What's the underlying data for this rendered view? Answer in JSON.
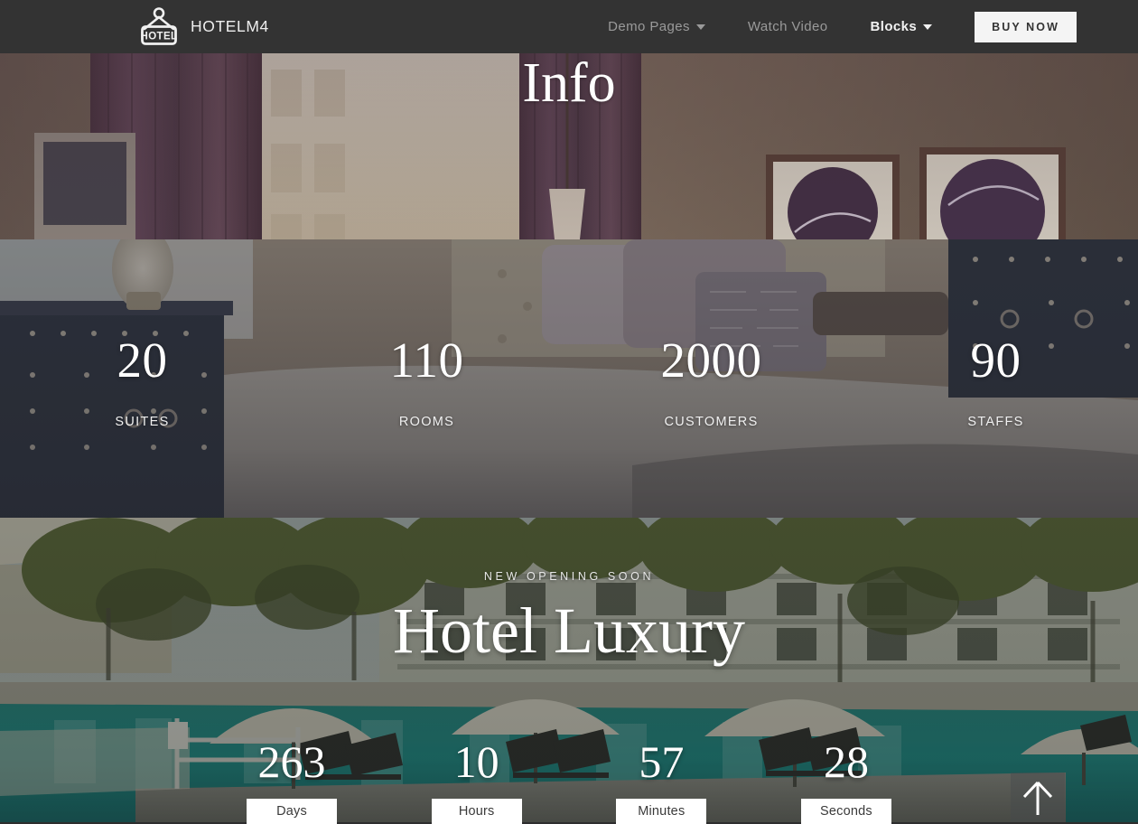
{
  "header": {
    "logo_icon": "hotel-sign-icon",
    "logo_text": "HOTEL",
    "brand": "HOTELM4",
    "nav": [
      {
        "label": "Demo Pages",
        "has_caret": true,
        "strong": false
      },
      {
        "label": "Watch Video",
        "has_caret": false,
        "strong": false
      },
      {
        "label": "Blocks",
        "has_caret": true,
        "strong": true
      }
    ],
    "cta": "BUY NOW",
    "bg_color": "#333333",
    "cta_bg": "#f4f4f4",
    "cta_text_color": "#333333"
  },
  "hero": {
    "title": "Info",
    "image_alt": "hotel-room-with-curtains-and-framed-art"
  },
  "stats": {
    "image_alt": "luxury-bedroom-with-tufted-headboard",
    "items": [
      {
        "value": "20",
        "label": "SUITES"
      },
      {
        "value": "110",
        "label": "ROOMS"
      },
      {
        "value": "2000",
        "label": "CUSTOMERS"
      },
      {
        "value": "90",
        "label": "STAFFS"
      }
    ]
  },
  "countdown": {
    "image_alt": "resort-swimming-pool-with-umbrellas",
    "eyebrow": "NEW OPENING SOON",
    "headline": "Hotel Luxury",
    "units": [
      {
        "value": "263",
        "label": "Days"
      },
      {
        "value": "10",
        "label": "Hours"
      },
      {
        "value": "57",
        "label": "Minutes"
      },
      {
        "value": "28",
        "label": "Seconds"
      }
    ],
    "scroll_top_icon": "arrow-up-icon",
    "label_bg": "#ffffff",
    "label_text_color": "#3a3a3a"
  }
}
